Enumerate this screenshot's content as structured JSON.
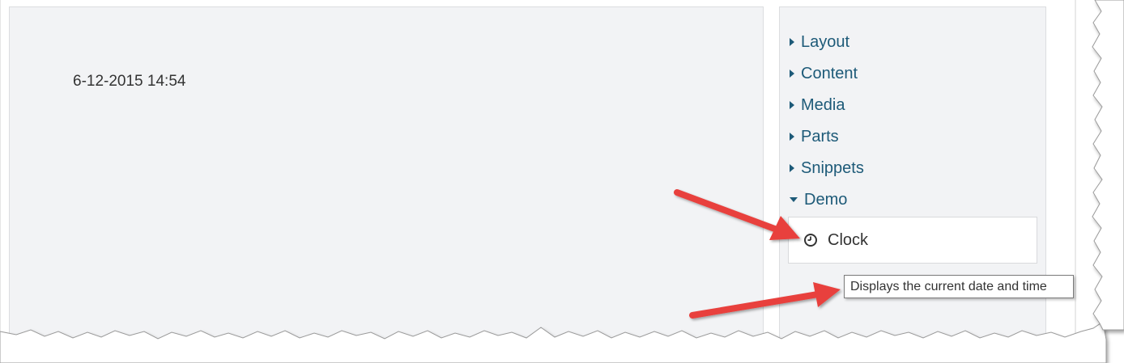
{
  "canvas": {
    "clock_value": "6-12-2015 14:54"
  },
  "toolbox": {
    "categories": [
      {
        "label": "Layout",
        "expanded": false
      },
      {
        "label": "Content",
        "expanded": false
      },
      {
        "label": "Media",
        "expanded": false
      },
      {
        "label": "Parts",
        "expanded": false
      },
      {
        "label": "Snippets",
        "expanded": false
      },
      {
        "label": "Demo",
        "expanded": true
      }
    ],
    "demo_items": [
      {
        "label": "Clock",
        "icon": "clock-icon"
      }
    ]
  },
  "tooltip": {
    "text": "Displays the current date and time"
  },
  "colors": {
    "link": "#1d5a78",
    "panel_bg": "#f2f3f5",
    "arrow": "#e8403c"
  }
}
